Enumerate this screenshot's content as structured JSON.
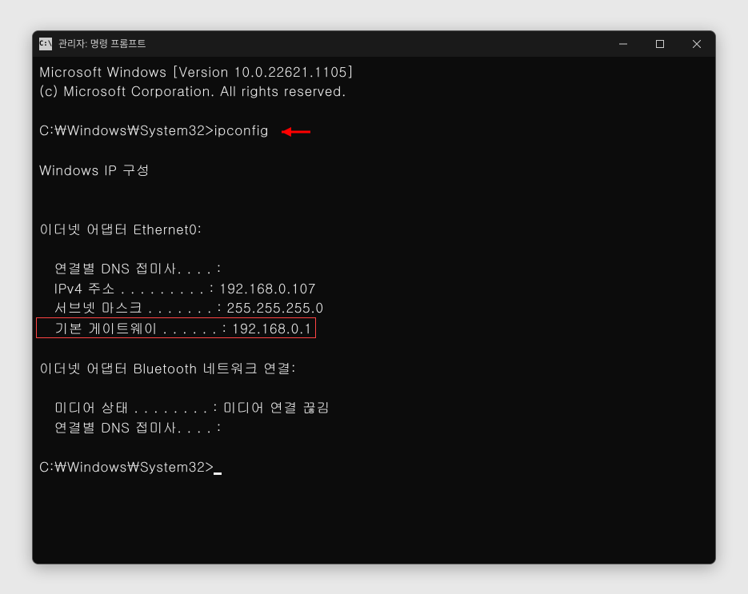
{
  "window": {
    "title": "관리자: 명령 프롬프트",
    "icon_label": "C:\\"
  },
  "output": {
    "line1": "Microsoft Windows [Version 10.0.22621.1105]",
    "line2": "(c) Microsoft Corporation. All rights reserved.",
    "blank1": "",
    "prompt_line": {
      "prompt": "C:\\Windows\\System32>",
      "command": "ipconfig"
    },
    "blank2": "",
    "header": "Windows IP 구성",
    "blank3": "",
    "blank4": "",
    "adapter1_title": "이더넷 어댑터 Ethernet0:",
    "blank5": "",
    "adapter1_dns": "   연결별 DNS 접미사. . . . :",
    "adapter1_ipv4": "   IPv4 주소 . . . . . . . . . : 192.168.0.107",
    "adapter1_subnet": "   서브넷 마스크 . . . . . . . : 255.255.255.0",
    "adapter1_gateway": "   기본 게이트웨이 . . . . . . : 192.168.0.1",
    "blank6": "",
    "adapter2_title": "이더넷 어댑터 Bluetooth 네트워크 연결:",
    "blank7": "",
    "adapter2_media": "   미디어 상태 . . . . . . . . : 미디어 연결 끊김",
    "adapter2_dns": "   연결별 DNS 접미사. . . . :",
    "blank8": "",
    "prompt2": "C:\\Windows\\System32>"
  }
}
